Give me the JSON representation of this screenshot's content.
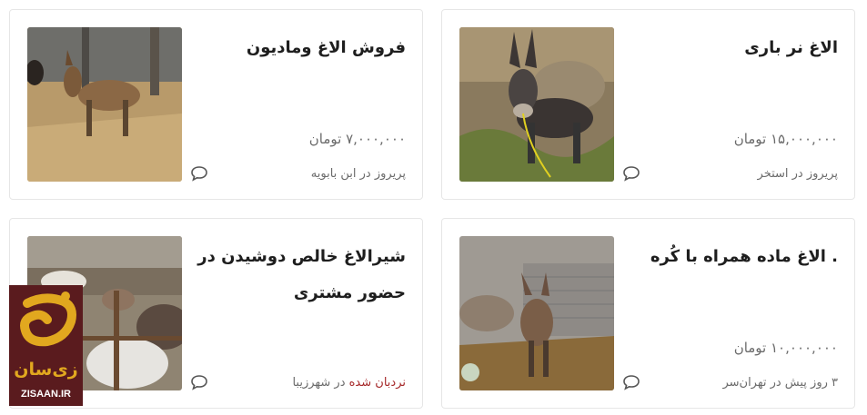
{
  "listings": [
    {
      "title": "الاغ نر باری",
      "price": "۱۵,۰۰۰,۰۰۰ تومان",
      "meta": "پریروز در استخر",
      "ladder": ""
    },
    {
      "title": "فروش الاغ ومادیون",
      "price": "۷,۰۰۰,۰۰۰ تومان",
      "meta": "پریروز در ابن بابویه",
      "ladder": ""
    },
    {
      "title": ". الاغ ماده همراه با کُره",
      "price": "۱۰,۰۰۰,۰۰۰ تومان",
      "meta": "۳ روز پیش در تهران‌سر",
      "ladder": ""
    },
    {
      "title": "شیرالاغ خالص دوشیدن در حضور مشتری",
      "price": "",
      "meta": " در شهرزیبا",
      "ladder": "نردبان شده"
    }
  ],
  "watermark": {
    "brand_fa": "زی‌سان",
    "brand_en": "ZISAAN.IR"
  },
  "colors": {
    "ladder_text": "#a62829",
    "logo_bg": "#5a1b1e",
    "logo_accent": "#e1a81f"
  }
}
